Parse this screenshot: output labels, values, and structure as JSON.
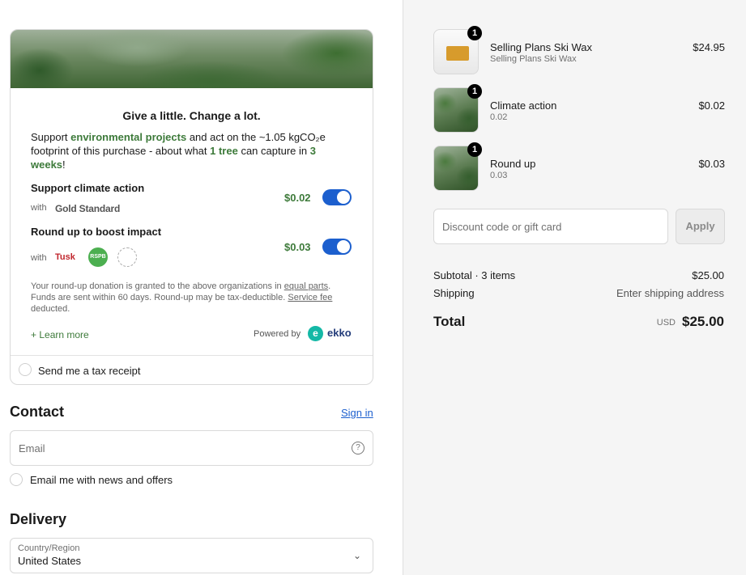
{
  "donation": {
    "title": "Give a little. Change a lot.",
    "intro_1": "Support ",
    "intro_link_projects": "environmental projects",
    "intro_2": " and act on the ~1.05 kgCO₂e footprint of this purchase - about what ",
    "intro_tree": "1 tree",
    "intro_3": " can capture in ",
    "intro_weeks": "3 weeks",
    "intro_4": "!",
    "climate": {
      "title": "Support climate action",
      "with": "with",
      "partner": "Gold Standard",
      "price": "$0.02",
      "enabled": true
    },
    "roundup": {
      "title": "Round up to boost impact",
      "with": "with",
      "partner_1": "Tusk",
      "partner_2": "RSPB",
      "price": "$0.03",
      "enabled": true
    },
    "note_1": "Your round-up donation is granted to the above organizations in ",
    "note_link_1": "equal parts",
    "note_2": ". Funds are sent within 60 days. Round-up may be tax-deductible. ",
    "note_link_2": "Service fee",
    "note_3": " deducted.",
    "learn_more": "+ Learn more",
    "powered_by": "Powered by",
    "brand_icon": "e",
    "brand": "ekko",
    "tax_receipt": "Send me a tax receipt"
  },
  "contact": {
    "heading": "Contact",
    "sign_in": "Sign in",
    "email_placeholder": "Email",
    "newsletter": "Email me with news and offers"
  },
  "delivery": {
    "heading": "Delivery",
    "country_label": "Country/Region",
    "country_value": "United States"
  },
  "cart": {
    "items": [
      {
        "name": "Selling Plans Ski Wax",
        "subtitle": "Selling Plans Ski Wax",
        "price": "$24.95",
        "qty": "1",
        "icon": "ski-wax-thumbnail"
      },
      {
        "name": "Climate action",
        "subtitle": "0.02",
        "price": "$0.02",
        "qty": "1",
        "icon": "forest-thumbnail"
      },
      {
        "name": "Round up",
        "subtitle": "0.03",
        "price": "$0.03",
        "qty": "1",
        "icon": "forest-thumbnail"
      }
    ],
    "discount_placeholder": "Discount code or gift card",
    "apply": "Apply",
    "subtotal_label": "Subtotal · 3 items",
    "subtotal_value": "$25.00",
    "shipping_label": "Shipping",
    "shipping_value": "Enter shipping address",
    "total_label": "Total",
    "currency": "USD",
    "total_value": "$25.00"
  },
  "colors": {
    "accent_green": "#3d7a3a",
    "toggle_blue": "#1c5fce",
    "link_blue": "#1c5fce"
  }
}
